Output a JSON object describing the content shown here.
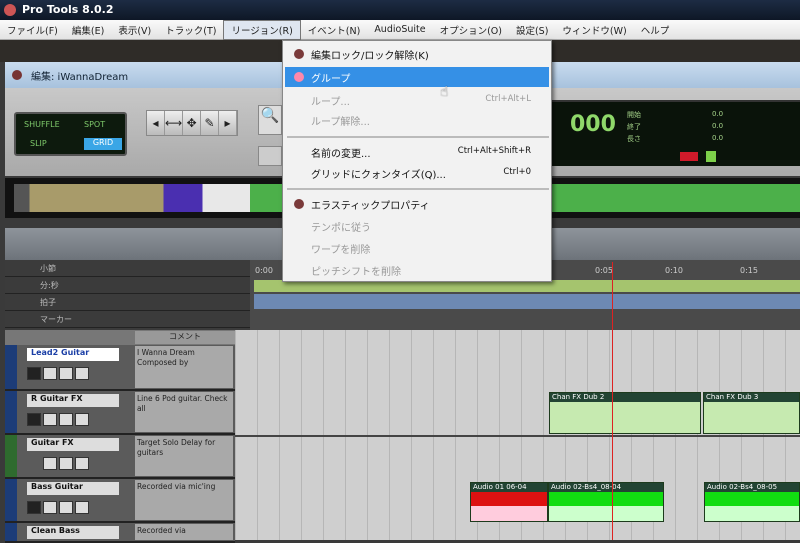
{
  "window": {
    "title": "Pro Tools 8.0.2"
  },
  "menubar": [
    "ファイル(F)",
    "編集(E)",
    "表示(V)",
    "トラック(T)",
    "リージョン(R)",
    "イベント(N)",
    "AudioSuite",
    "オプション(O)",
    "設定(S)",
    "ウィンドウ(W)",
    "ヘルプ"
  ],
  "region_menu": {
    "items": [
      {
        "label": "編集ロック/ロック解除(K)",
        "shortcut": "",
        "state": "normal"
      },
      {
        "label": "グループ",
        "shortcut": "",
        "state": "highlighted"
      },
      {
        "label": "ループ...",
        "shortcut": "Ctrl+Alt+L",
        "state": "disabled"
      },
      {
        "label": "ループ解除...",
        "shortcut": "",
        "state": "disabled"
      },
      {
        "label": "名前の変更...",
        "shortcut": "Ctrl+Alt+Shift+R",
        "state": "normal"
      },
      {
        "label": "グリッドにクォンタイズ(Q)...",
        "shortcut": "Ctrl+0",
        "state": "normal"
      },
      {
        "label": "エラスティックプロパティ",
        "shortcut": "",
        "state": "normal"
      },
      {
        "label": "テンポに従う",
        "shortcut": "",
        "state": "disabled"
      },
      {
        "label": "ワープを削除",
        "shortcut": "",
        "state": "disabled"
      },
      {
        "label": "ピッチシフトを削除",
        "shortcut": "",
        "state": "disabled"
      }
    ]
  },
  "edit_window": {
    "title": "編集: iWannaDream"
  },
  "toolbar": {
    "modes": [
      "SHUFFLE",
      "SPOT",
      "SLIP",
      "GRID"
    ],
    "tools": [
      "◂",
      "⟷",
      "✥",
      "✎",
      "▸"
    ],
    "zoom_icon": "🔍"
  },
  "counter": {
    "main": "000",
    "labels": [
      "開始",
      "終了",
      "長さ"
    ],
    "values": [
      "0.0",
      "0.0",
      "0.0"
    ]
  },
  "rulers": {
    "rows": [
      "小節",
      "分:秒",
      "拍子",
      "マーカー"
    ],
    "ticks": [
      "0:00",
      "0:05",
      "0:10",
      "0:15"
    ]
  },
  "comments_header": "コメント",
  "tracks": [
    {
      "name": "Lead2 Guitar",
      "comment": "I Wanna Dream Composed by",
      "selected": true
    },
    {
      "name": "R Guitar FX",
      "comment": "Line 6 Pod guitar. Check all",
      "selected": false
    },
    {
      "name": "Guitar FX",
      "comment": "Target Solo Delay for guitars",
      "selected": false
    },
    {
      "name": "Bass Guitar",
      "comment": "Recorded via mic'ing",
      "selected": false
    },
    {
      "name": "Clean Bass",
      "comment": "Recorded via",
      "selected": false
    }
  ],
  "regions": {
    "guitar_fx": [
      "Chan FX Dub 2",
      "Chan FX Dub 3"
    ],
    "bass": [
      "Audio 01 06-04",
      "Audio 02-Bs4_08-04",
      "Audio 02-Bs4_08-05"
    ]
  }
}
